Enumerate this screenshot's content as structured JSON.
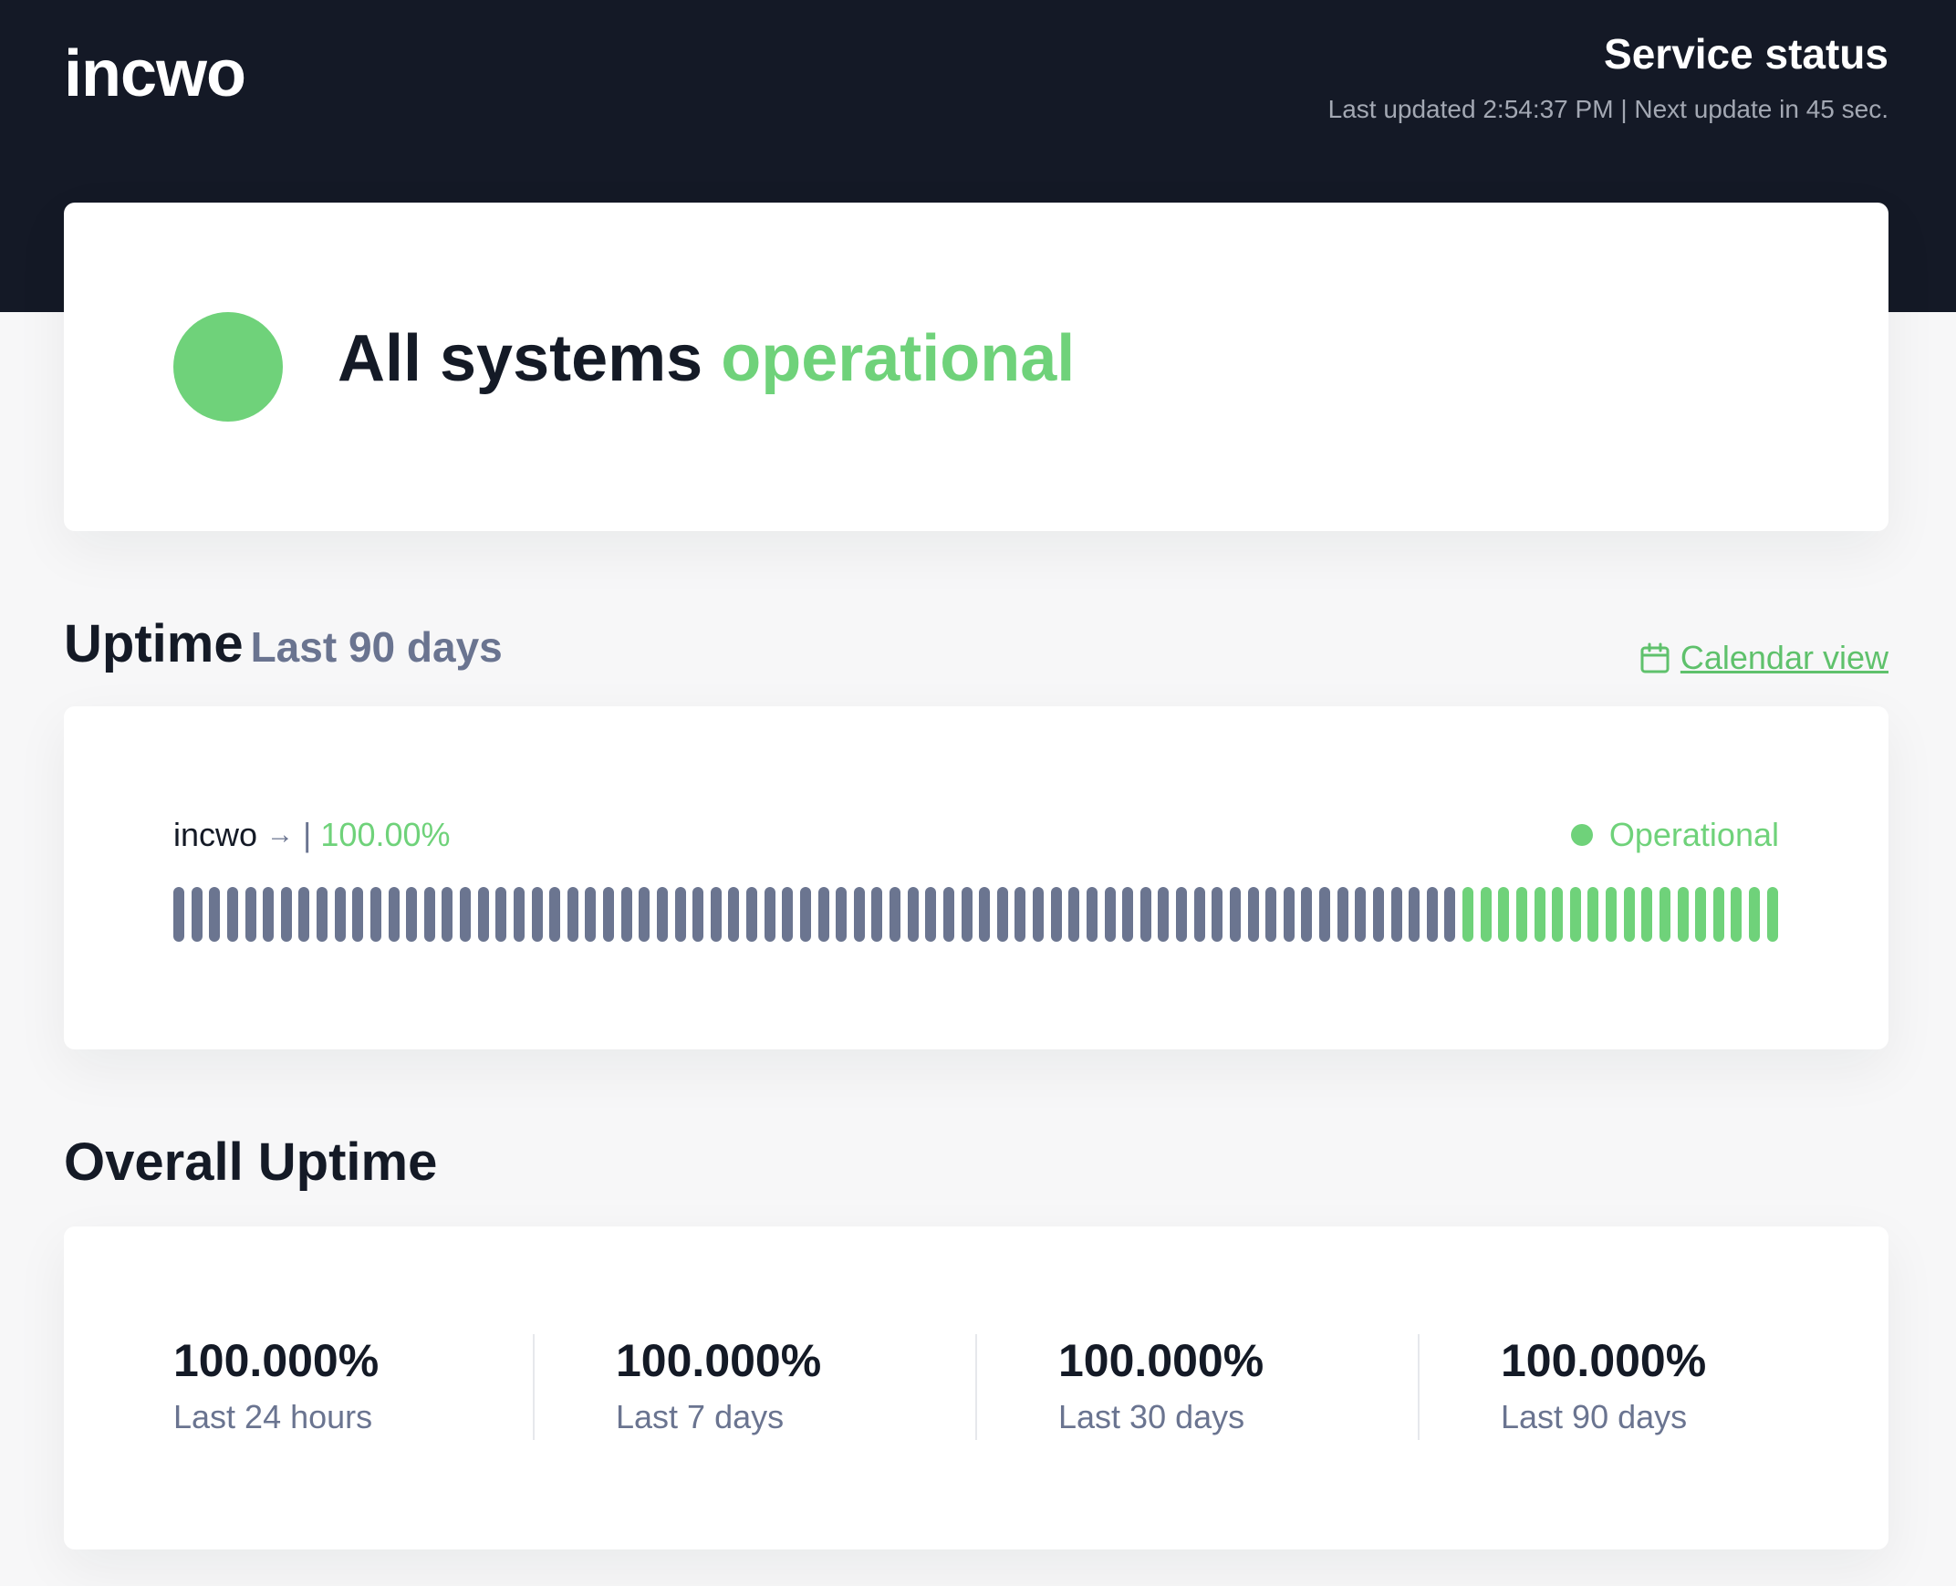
{
  "header": {
    "logo": "incwo",
    "title": "Service status",
    "subtitle": "Last updated 2:54:37 PM | Next update in 45 sec."
  },
  "status": {
    "prefix": "All systems",
    "state": "operational",
    "color": "#6fd27a"
  },
  "uptime": {
    "title": "Uptime",
    "period": "Last 90 days",
    "calendar_link": "Calendar view",
    "calendar_icon": "calendar-icon",
    "monitor": {
      "name": "incwo",
      "arrow": "→",
      "separator": "|",
      "percent": "100.00%",
      "status": "Operational",
      "days_total": 90,
      "days_no_data": 72,
      "days_operational": 18,
      "no_data_color": "#6b7590",
      "operational_color": "#6fd27a"
    }
  },
  "overall": {
    "title": "Overall Uptime",
    "stats": [
      {
        "value": "100.000%",
        "label": "Last 24 hours"
      },
      {
        "value": "100.000%",
        "label": "Last 7 days"
      },
      {
        "value": "100.000%",
        "label": "Last 30 days"
      },
      {
        "value": "100.000%",
        "label": "Last 90 days"
      }
    ]
  }
}
